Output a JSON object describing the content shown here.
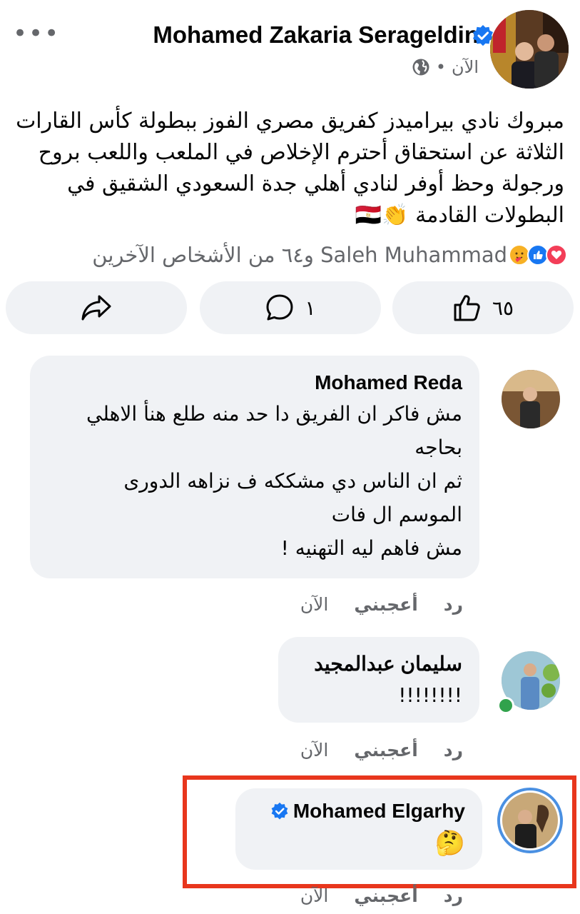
{
  "post": {
    "author": "Mohamed Zakaria Serageldin",
    "time": "الآن",
    "separator": "•",
    "text": "مبروك نادي بيراميدز كفريق مصري الفوز ببطولة كأس القارات الثلاثة عن استحقاق أحترم الإخلاص في الملعب واللعب بروح ورجولة وحظ أوفر لنادي أهلي جدة السعودي الشقيق في البطولات القادمة 👏🇪🇬",
    "reactions_summary": "Saleh Muhammad و٦٤ من الأشخاص الآخرين",
    "like_count": "٦٥",
    "comment_count": "١"
  },
  "comments": [
    {
      "name": "Mohamed Reda",
      "lines": [
        "مش فاكر ان الفريق دا حد منه طلع هنأ الاهلي",
        "بحاجه",
        "ثم ان الناس دي مشككه ف نزاهه الدورى",
        "الموسم ال فات",
        "مش فاهم ليه التهنيه !"
      ],
      "time": "الآن",
      "like": "أعجبني",
      "reply": "رد"
    },
    {
      "name": "سليمان عبدالمجيد",
      "lines": [
        "!!!!!!!!"
      ],
      "time": "الآن",
      "like": "أعجبني",
      "reply": "رد"
    },
    {
      "name": "Mohamed Elgarhy",
      "lines": [
        "🤔"
      ],
      "time": "الآن",
      "like": "أعجبني",
      "reply": "رد"
    }
  ],
  "colors": {
    "verified": "#1877f2",
    "bubble": "#f0f2f5",
    "highlight": "#e8361d",
    "online": "#31a24c"
  }
}
